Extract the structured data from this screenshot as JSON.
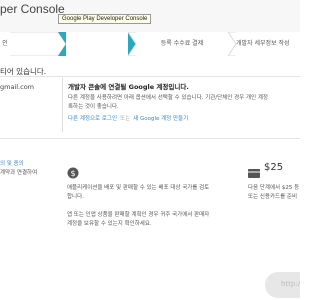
{
  "header": {
    "title": "per Console",
    "tooltip": "Google Play Developer Console"
  },
  "steps": [
    {
      "label": "인",
      "active": false
    },
    {
      "label": "개발자 계약 수락",
      "active": true
    },
    {
      "label": "등록 수수료 결제",
      "active": false
    },
    {
      "label": "개발자 세부정보 작성",
      "active": false
    }
  ],
  "intro": "티어 있습니다.",
  "account": {
    "email": "gmail.com"
  },
  "panel": {
    "title": "개발자 콘솔에 연결될 Google 계정입니다.",
    "desc_line1": "다른 계정을 사용하려면 아래 옵션에서 선택할 수 있습니다. 기관/단체인 경우 개인 계정",
    "desc_line2": "록하는 것이 좋습니다.",
    "link_signin": "다른 계정으로 로그인",
    "link_new": "새 Google 계정 만들기",
    "link_sep": "또는"
  },
  "columns": {
    "left_line1": "의 및 종의",
    "left_line2": "계약과 연결하여",
    "mid_line1": "애플리케이션을 배포 및 판매할 수 있는 배포 대상 국가를 검토",
    "mid_line2": "합니다.",
    "mid_line3": "앱 또는 인앱 상품을 판매할 계획인 경우 귀주 국가에서 판매자",
    "mid_line4": "계정을 보유할 수 있는지 확인하세요.",
    "right_line1": "다음 단계에서 $25 등",
    "right_line2": "또는 신용카드를 준비"
  },
  "price": "$25",
  "watermark": "http://",
  "colors": {
    "accent": "#2aa8c0",
    "link": "#3a89c9"
  },
  "icons": {
    "dollar": "globe-dollar-icon",
    "card": "credit-card-icon"
  }
}
